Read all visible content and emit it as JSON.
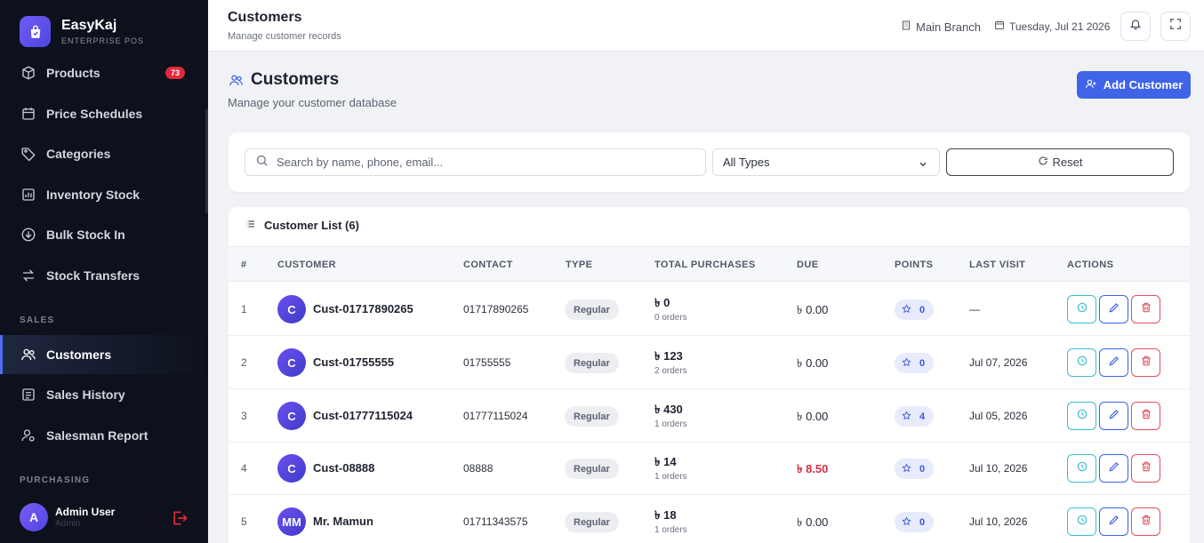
{
  "app": {
    "name": "EasyKaj",
    "subtitle": "ENTERPRISE POS"
  },
  "sidebar": {
    "items": [
      {
        "label": "Products",
        "icon": "box-icon",
        "badge": "73"
      },
      {
        "label": "Price Schedules",
        "icon": "calendar-icon"
      },
      {
        "label": "Categories",
        "icon": "tag-icon"
      },
      {
        "label": "Inventory Stock",
        "icon": "chart-box-icon"
      },
      {
        "label": "Bulk Stock In",
        "icon": "download-circle-icon"
      },
      {
        "label": "Stock Transfers",
        "icon": "transfer-icon"
      },
      {
        "label": "Customers",
        "icon": "users-icon",
        "active": true
      },
      {
        "label": "Sales History",
        "icon": "list-box-icon"
      },
      {
        "label": "Salesman Report",
        "icon": "user-report-icon"
      }
    ],
    "sections": {
      "sales": "SALES",
      "purchasing": "PURCHASING"
    },
    "user": {
      "initial": "A",
      "name": "Admin User",
      "role": "Admin"
    }
  },
  "topbar": {
    "title": "Customers",
    "subtitle": "Manage customer records",
    "branch": "Main Branch",
    "date": "Tuesday, Jul 21 2026"
  },
  "page": {
    "title": "Customers",
    "subtitle": "Manage your customer database",
    "add_button": "Add Customer"
  },
  "filters": {
    "search_placeholder": "Search by name, phone, email...",
    "type_selected": "All Types",
    "reset_label": "Reset"
  },
  "table": {
    "title": "Customer List (6)",
    "columns": [
      "#",
      "CUSTOMER",
      "CONTACT",
      "TYPE",
      "TOTAL PURCHASES",
      "DUE",
      "POINTS",
      "LAST VISIT",
      "ACTIONS"
    ],
    "rows": [
      {
        "num": "1",
        "initials": "C",
        "name": "Cust-01717890265",
        "contact": "01717890265",
        "type": "Regular",
        "total": "৳ 0",
        "orders": "0 orders",
        "due": "৳ 0.00",
        "due_red": false,
        "points": "0",
        "last_visit": "—"
      },
      {
        "num": "2",
        "initials": "C",
        "name": "Cust-01755555",
        "contact": "01755555",
        "type": "Regular",
        "total": "৳ 123",
        "orders": "2 orders",
        "due": "৳ 0.00",
        "due_red": false,
        "points": "0",
        "last_visit": "Jul 07, 2026"
      },
      {
        "num": "3",
        "initials": "C",
        "name": "Cust-01777115024",
        "contact": "01777115024",
        "type": "Regular",
        "total": "৳ 430",
        "orders": "1 orders",
        "due": "৳ 0.00",
        "due_red": false,
        "points": "4",
        "last_visit": "Jul 05, 2026"
      },
      {
        "num": "4",
        "initials": "C",
        "name": "Cust-08888",
        "contact": "08888",
        "type": "Regular",
        "total": "৳ 14",
        "orders": "1 orders",
        "due": "৳ 8.50",
        "due_red": true,
        "points": "0",
        "last_visit": "Jul 10, 2026"
      },
      {
        "num": "5",
        "initials": "MM",
        "name": "Mr. Mamun",
        "contact": "01711343575",
        "type": "Regular",
        "total": "৳ 18",
        "orders": "1 orders",
        "due": "৳ 0.00",
        "due_red": false,
        "points": "0",
        "last_visit": "Jul 10, 2026"
      }
    ]
  },
  "colors": {
    "accent": "#3f64e8",
    "sidebar_bg": "#0d111c",
    "danger": "#d33040",
    "teal": "#36c0cf"
  }
}
